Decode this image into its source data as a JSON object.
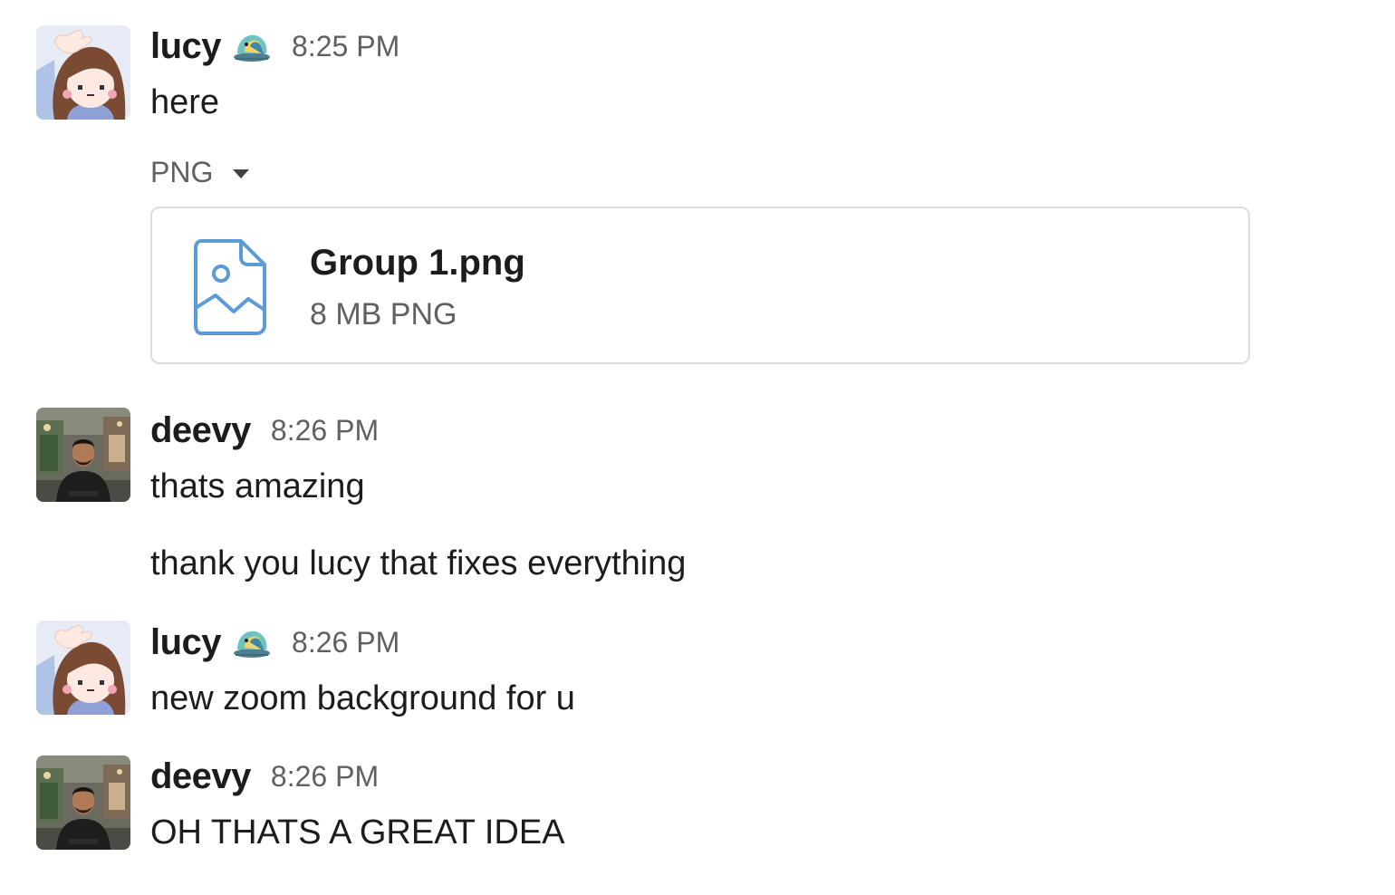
{
  "messages": [
    {
      "user": "lucy",
      "status_emoji": "parrot-icon",
      "time": "8:25 PM",
      "lines": [
        "here"
      ],
      "attachment": {
        "type_label": "PNG",
        "file_name": "Group 1.png",
        "meta": "8 MB PNG",
        "icon": "image-file-icon"
      }
    },
    {
      "user": "deevy",
      "time": "8:26 PM",
      "lines": [
        "thats amazing",
        "thank you lucy that fixes everything"
      ]
    },
    {
      "user": "lucy",
      "status_emoji": "parrot-icon",
      "time": "8:26 PM",
      "lines": [
        "new zoom background for u"
      ]
    },
    {
      "user": "deevy",
      "time": "8:26 PM",
      "lines": [
        "OH THATS A GREAT IDEA"
      ]
    }
  ],
  "colors": {
    "text": "#1d1c1d",
    "muted": "#616061",
    "file_icon": "#5a9bd8",
    "card_border": "#dddddd"
  }
}
